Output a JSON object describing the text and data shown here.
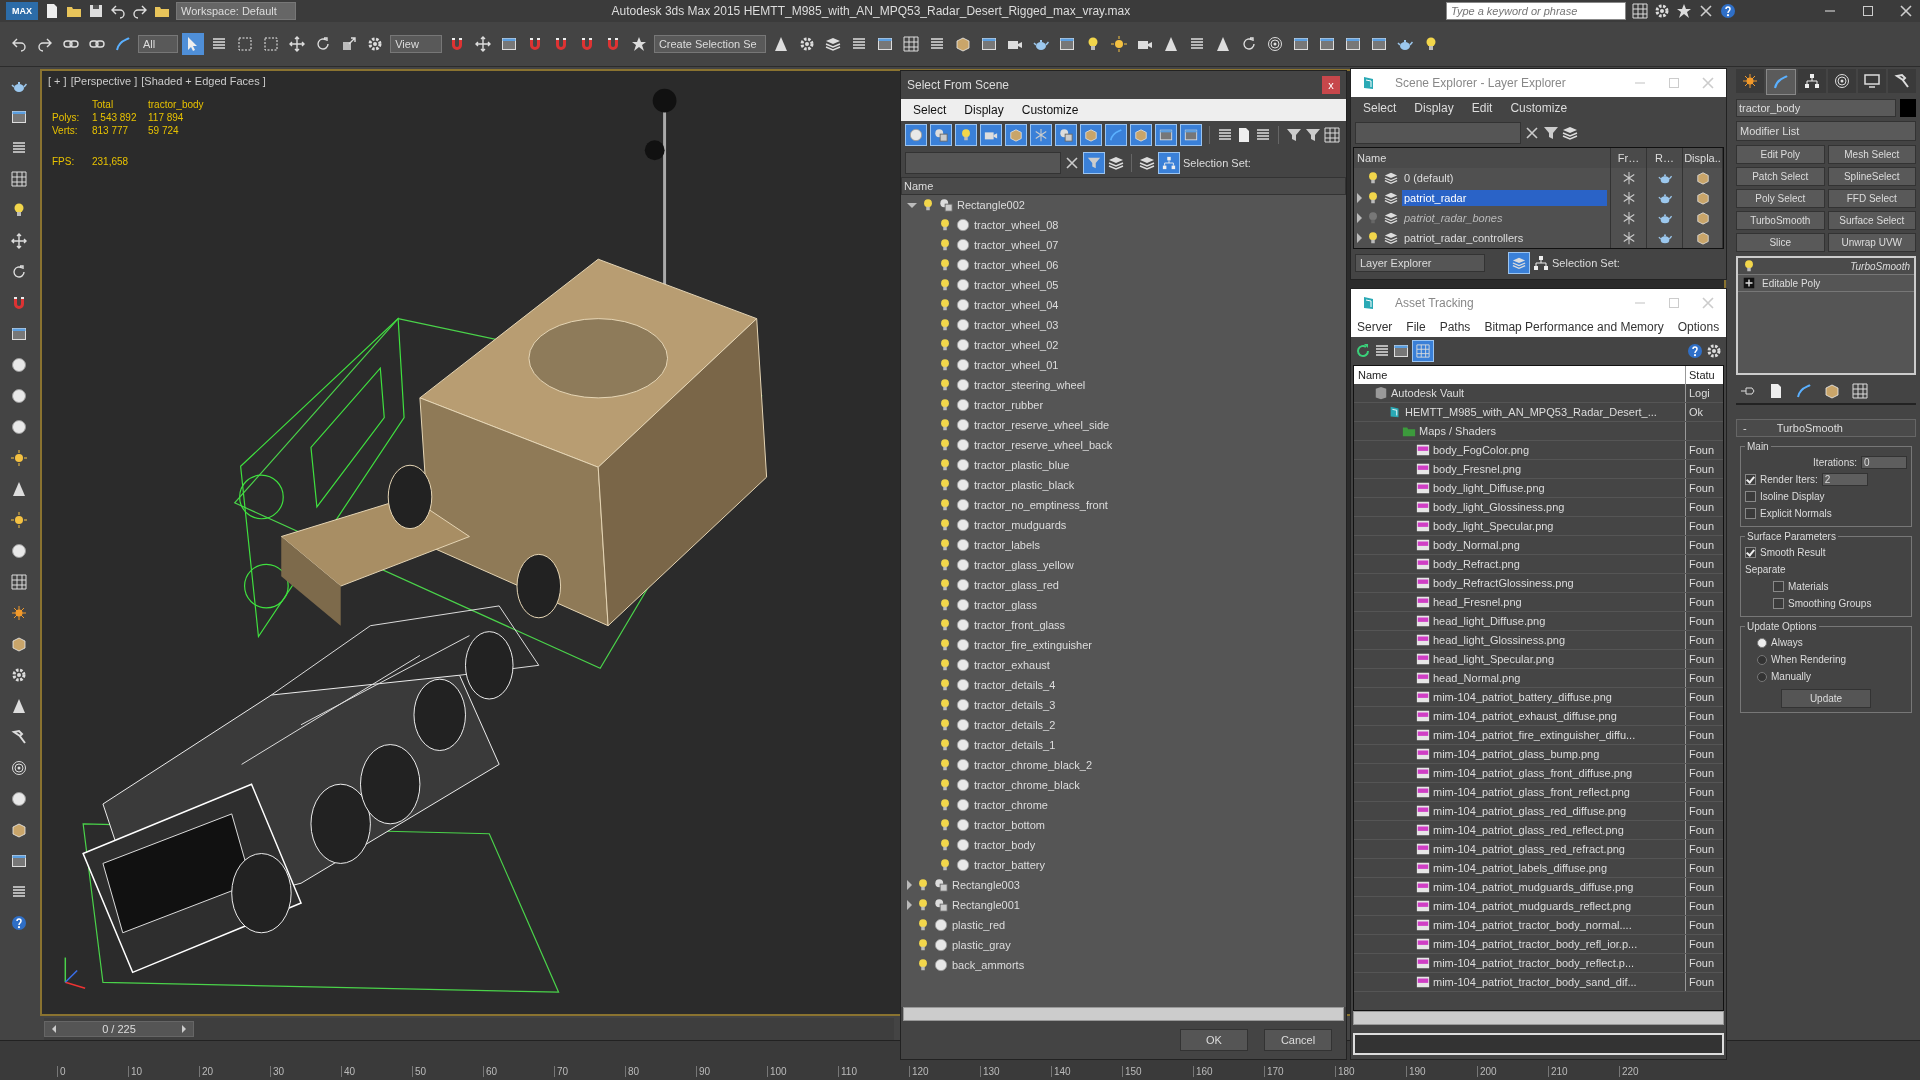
{
  "app": {
    "logo": "MAX",
    "workspace": "Workspace: Default",
    "title": "Autodesk 3ds Max  2015    HEMTT_M985_with_AN_MPQ53_Radar_Desert_Rigged_max_vray.max",
    "search_placeholder": "Type a keyword or phrase"
  },
  "toolbar": {
    "selection_filter": "All",
    "reference_coordinate": "View",
    "named_selection": "Create Selection Se"
  },
  "viewport": {
    "labels": [
      "[ + ]",
      "[Perspective ]",
      "[Shaded + Edged Faces ]"
    ],
    "stats_headers": [
      "Total",
      "tractor_body"
    ],
    "stats": [
      {
        "label": "Polys:",
        "total": "1 543 892",
        "object": "117 894"
      },
      {
        "label": "Verts:",
        "total": "813 777",
        "object": "59 724"
      }
    ],
    "fps_label": "FPS:",
    "fps": "231,658"
  },
  "select_from_scene": {
    "title": "Select From Scene",
    "close": "x",
    "menu": [
      "Select",
      "Display",
      "Customize"
    ],
    "selection_set_label": "Selection Set:",
    "column": "Name",
    "buttons": [
      "OK",
      "Cancel"
    ],
    "objects": [
      {
        "name": "Rectangle002",
        "kind": "group",
        "expanded": true,
        "children": [
          {
            "name": "tractor_wheel_08",
            "kind": "mesh"
          },
          {
            "name": "tractor_wheel_07",
            "kind": "mesh"
          },
          {
            "name": "tractor_wheel_06",
            "kind": "mesh"
          },
          {
            "name": "tractor_wheel_05",
            "kind": "mesh"
          },
          {
            "name": "tractor_wheel_04",
            "kind": "mesh"
          },
          {
            "name": "tractor_wheel_03",
            "kind": "mesh"
          },
          {
            "name": "tractor_wheel_02",
            "kind": "mesh"
          },
          {
            "name": "tractor_wheel_01",
            "kind": "mesh"
          },
          {
            "name": "tractor_steering_wheel",
            "kind": "mesh"
          },
          {
            "name": "tractor_rubber",
            "kind": "mesh"
          },
          {
            "name": "tractor_reserve_wheel_side",
            "kind": "mesh"
          },
          {
            "name": "tractor_reserve_wheel_back",
            "kind": "mesh"
          },
          {
            "name": "tractor_plastic_blue",
            "kind": "mesh"
          },
          {
            "name": "tractor_plastic_black",
            "kind": "mesh"
          },
          {
            "name": "tractor_no_emptiness_front",
            "kind": "mesh"
          },
          {
            "name": "tractor_mudguards",
            "kind": "mesh"
          },
          {
            "name": "tractor_labels",
            "kind": "mesh"
          },
          {
            "name": "tractor_glass_yellow",
            "kind": "mesh"
          },
          {
            "name": "tractor_glass_red",
            "kind": "mesh"
          },
          {
            "name": "tractor_glass",
            "kind": "mesh"
          },
          {
            "name": "tractor_front_glass",
            "kind": "mesh"
          },
          {
            "name": "tractor_fire_extinguisher",
            "kind": "mesh"
          },
          {
            "name": "tractor_exhaust",
            "kind": "mesh"
          },
          {
            "name": "tractor_details_4",
            "kind": "mesh"
          },
          {
            "name": "tractor_details_3",
            "kind": "mesh"
          },
          {
            "name": "tractor_details_2",
            "kind": "mesh"
          },
          {
            "name": "tractor_details_1",
            "kind": "mesh"
          },
          {
            "name": "tractor_chrome_black_2",
            "kind": "mesh"
          },
          {
            "name": "tractor_chrome_black",
            "kind": "mesh"
          },
          {
            "name": "tractor_chrome",
            "kind": "mesh"
          },
          {
            "name": "tractor_bottom",
            "kind": "mesh"
          },
          {
            "name": "tractor_body",
            "kind": "mesh"
          },
          {
            "name": "tractor_battery",
            "kind": "mesh"
          }
        ]
      },
      {
        "name": "Rectangle003",
        "kind": "group",
        "expanded": false
      },
      {
        "name": "Rectangle001",
        "kind": "group",
        "expanded": false
      },
      {
        "name": "plastic_red",
        "kind": "mesh"
      },
      {
        "name": "plastic_gray",
        "kind": "mesh"
      },
      {
        "name": "back_ammorts",
        "kind": "mesh"
      }
    ]
  },
  "scene_explorer": {
    "title": "Scene Explorer - Layer Explorer",
    "menu": [
      "Select",
      "Display",
      "Edit",
      "Customize"
    ],
    "columns": [
      "Name",
      "Fr…",
      "R…",
      "Displa.."
    ],
    "layers": [
      {
        "name": "0 (default)",
        "selected": false,
        "visible": true
      },
      {
        "name": "patriot_radar",
        "selected": true,
        "visible": true,
        "expanded": false
      },
      {
        "name": "patriot_radar_bones",
        "selected": false,
        "visible": false,
        "expanded": false
      },
      {
        "name": "patriot_radar_controllers",
        "selected": false,
        "visible": true,
        "expanded": false
      }
    ],
    "explorer_mode": "Layer Explorer",
    "selection_set_label": "Selection Set:"
  },
  "asset_tracking": {
    "title": "Asset Tracking",
    "menu": [
      "Server",
      "File",
      "Paths",
      "Bitmap Performance and Memory",
      "Options"
    ],
    "columns": [
      "Name",
      "Statu"
    ],
    "assets": [
      {
        "name": "Autodesk Vault",
        "status": "Logi",
        "kind": "vault",
        "children": [
          {
            "name": "HEMTT_M985_with_AN_MPQ53_Radar_Desert_...",
            "status": "Ok",
            "kind": "scene",
            "children": [
              {
                "name": "Maps / Shaders",
                "kind": "folder",
                "children": [
                  {
                    "name": "body_FogColor.png",
                    "status": "Foun",
                    "kind": "image"
                  },
                  {
                    "name": "body_Fresnel.png",
                    "status": "Foun",
                    "kind": "image"
                  },
                  {
                    "name": "body_light_Diffuse.png",
                    "status": "Foun",
                    "kind": "image"
                  },
                  {
                    "name": "body_light_Glossiness.png",
                    "status": "Foun",
                    "kind": "image"
                  },
                  {
                    "name": "body_light_Specular.png",
                    "status": "Foun",
                    "kind": "image"
                  },
                  {
                    "name": "body_Normal.png",
                    "status": "Foun",
                    "kind": "image"
                  },
                  {
                    "name": "body_Refract.png",
                    "status": "Foun",
                    "kind": "image"
                  },
                  {
                    "name": "body_RefractGlossiness.png",
                    "status": "Foun",
                    "kind": "image"
                  },
                  {
                    "name": "head_Fresnel.png",
                    "status": "Foun",
                    "kind": "image"
                  },
                  {
                    "name": "head_light_Diffuse.png",
                    "status": "Foun",
                    "kind": "image"
                  },
                  {
                    "name": "head_light_Glossiness.png",
                    "status": "Foun",
                    "kind": "image"
                  },
                  {
                    "name": "head_light_Specular.png",
                    "status": "Foun",
                    "kind": "image"
                  },
                  {
                    "name": "head_Normal.png",
                    "status": "Foun",
                    "kind": "image"
                  },
                  {
                    "name": "mim-104_patriot_battery_diffuse.png",
                    "status": "Foun",
                    "kind": "image"
                  },
                  {
                    "name": "mim-104_patriot_exhaust_diffuse.png",
                    "status": "Foun",
                    "kind": "image"
                  },
                  {
                    "name": "mim-104_patriot_fire_extinguisher_diffu...",
                    "status": "Foun",
                    "kind": "image"
                  },
                  {
                    "name": "mim-104_patriot_glass_bump.png",
                    "status": "Foun",
                    "kind": "image"
                  },
                  {
                    "name": "mim-104_patriot_glass_front_diffuse.png",
                    "status": "Foun",
                    "kind": "image"
                  },
                  {
                    "name": "mim-104_patriot_glass_front_reflect.png",
                    "status": "Foun",
                    "kind": "image"
                  },
                  {
                    "name": "mim-104_patriot_glass_red_diffuse.png",
                    "status": "Foun",
                    "kind": "image"
                  },
                  {
                    "name": "mim-104_patriot_glass_red_reflect.png",
                    "status": "Foun",
                    "kind": "image"
                  },
                  {
                    "name": "mim-104_patriot_glass_red_refract.png",
                    "status": "Foun",
                    "kind": "image"
                  },
                  {
                    "name": "mim-104_patriot_labels_diffuse.png",
                    "status": "Foun",
                    "kind": "image"
                  },
                  {
                    "name": "mim-104_patriot_mudguards_diffuse.png",
                    "status": "Foun",
                    "kind": "image"
                  },
                  {
                    "name": "mim-104_patriot_mudguards_reflect.png",
                    "status": "Foun",
                    "kind": "image"
                  },
                  {
                    "name": "mim-104_patriot_tractor_body_normal....",
                    "status": "Foun",
                    "kind": "image"
                  },
                  {
                    "name": "mim-104_patriot_tractor_body_refl_ior.p...",
                    "status": "Foun",
                    "kind": "image"
                  },
                  {
                    "name": "mim-104_patriot_tractor_body_reflect.p...",
                    "status": "Foun",
                    "kind": "image"
                  },
                  {
                    "name": "mim-104_patriot_tractor_body_sand_dif...",
                    "status": "Foun",
                    "kind": "image"
                  }
                ]
              }
            ]
          }
        ]
      }
    ]
  },
  "command_panel": {
    "tabs": [
      {
        "selected": false
      },
      {
        "selected": true
      },
      {
        "selected": false
      },
      {
        "selected": false
      },
      {
        "selected": false
      },
      {
        "selected": false
      }
    ],
    "object_name": "tractor_body",
    "modifier_list": "Modifier List",
    "modifier_buttons": [
      "Edit Poly",
      "Mesh Select",
      "Patch Select",
      "SplineSelect",
      "Poly Select",
      "FFD Select",
      "TurboSmooth",
      "Surface Select",
      "Slice",
      "Unwrap UVW"
    ],
    "stack": [
      {
        "name": "TurboSmooth",
        "kind": "modifier"
      },
      {
        "name": "Editable Poly",
        "kind": "base"
      }
    ],
    "rollout": {
      "collapse": "-",
      "title": "TurboSmooth",
      "groups": [
        {
          "title": "Main",
          "controls": [
            {
              "kind": "spinner",
              "label": "Iterations:",
              "value": "0"
            },
            {
              "kind": "check-spinner",
              "label": "Render Iters:",
              "checked": true,
              "value": "2"
            },
            {
              "kind": "checkbox",
              "label": "Isoline Display",
              "checked": false
            },
            {
              "kind": "checkbox",
              "label": "Explicit Normals",
              "checked": false
            }
          ]
        },
        {
          "title": "Surface Parameters",
          "controls": [
            {
              "kind": "checkbox",
              "label": "Smooth Result",
              "checked": true
            },
            {
              "kind": "label",
              "label": "Separate"
            },
            {
              "kind": "subcheckbox",
              "label": "Materials",
              "checked": false
            },
            {
              "kind": "subcheckbox",
              "label": "Smoothing Groups",
              "checked": false
            }
          ]
        },
        {
          "title": "Update Options",
          "controls": [
            {
              "kind": "radio",
              "label": "Always",
              "selected": true
            },
            {
              "kind": "radio",
              "label": "When Rendering",
              "selected": false
            },
            {
              "kind": "radio",
              "label": "Manually",
              "selected": false
            },
            {
              "kind": "button",
              "label": "Update"
            }
          ]
        }
      ]
    }
  },
  "timeline": {
    "frame": "0 / 225",
    "level": 0,
    "ticks": [
      "0",
      "10",
      "20",
      "30",
      "40",
      "50",
      "60",
      "70",
      "80",
      "90",
      "100",
      "110",
      "120",
      "130",
      "140",
      "150",
      "160",
      "170",
      "180",
      "190",
      "200",
      "210",
      "220"
    ]
  }
}
